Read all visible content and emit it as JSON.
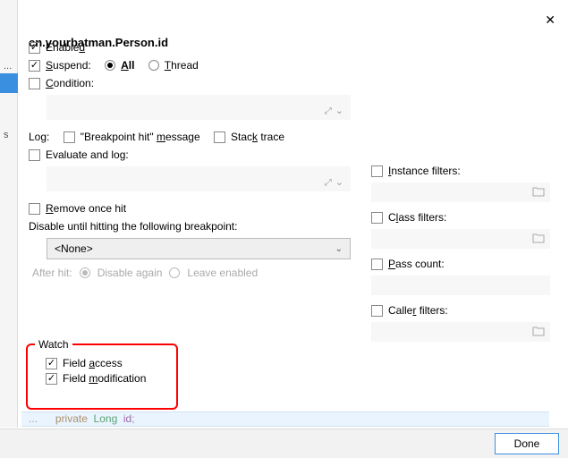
{
  "title": "cn.yourbatman.Person.id",
  "leftbar": {
    "pre": "...",
    "item": "s"
  },
  "enabled": {
    "label_pre": "Enable",
    "label_u": "d",
    "checked": true
  },
  "suspend": {
    "label_u": "S",
    "label_post": "uspend:",
    "checked": true,
    "all": {
      "label_u": "A",
      "label_post": "ll",
      "selected": true
    },
    "thread": {
      "label_u": "T",
      "label_post": "hread",
      "selected": false
    }
  },
  "condition": {
    "label_u": "C",
    "label_post": "ondition:",
    "checked": false
  },
  "log": {
    "prefix": "Log:",
    "bpmsg": {
      "label_pre": "\"Breakpoint hit\" ",
      "label_u": "m",
      "label_post": "essage",
      "checked": false
    },
    "stack": {
      "label_pre": "Stac",
      "label_u": "k",
      "label_post": " trace",
      "checked": false
    }
  },
  "evallog": {
    "label_pre": "Evaluate and lo",
    "label_u": "g",
    "label_post": ":",
    "checked": false
  },
  "removeonce": {
    "label_u": "R",
    "label_post": "emove once hit",
    "checked": false
  },
  "disable_until": "Disable until hitting the following breakpoint:",
  "none_option": "<None>",
  "after_hit": {
    "label": "After hit:",
    "again": "Disable again",
    "leave": "Leave enabled"
  },
  "filters": {
    "instance": {
      "label_u": "I",
      "label_post": "nstance filters:",
      "checked": false
    },
    "class": {
      "label_pre": "C",
      "label_u": "l",
      "label_post": "ass filters:",
      "checked": false
    },
    "pass": {
      "label_u": "P",
      "label_post": "ass count:",
      "checked": false
    },
    "caller": {
      "label_pre": "Calle",
      "label_u": "r",
      "label_post": " filters:",
      "checked": false
    }
  },
  "watch": {
    "legend": "Watch",
    "access": {
      "label_pre": "Field ",
      "label_u": "a",
      "label_post": "ccess",
      "checked": true
    },
    "modif": {
      "label_pre": "Field ",
      "label_u": "m",
      "label_post": "odification",
      "checked": true
    }
  },
  "code": {
    "blur": "...",
    "kw1": "private",
    "ty": "Long",
    "id": "id",
    "semi": ";"
  },
  "done": "Done"
}
